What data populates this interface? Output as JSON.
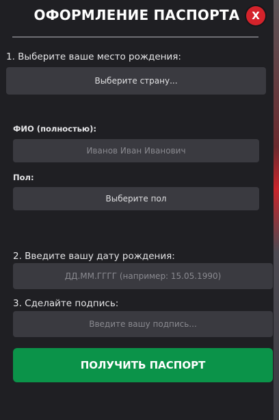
{
  "dialog": {
    "title": "ОФОРМЛЕНИЕ ПАСПОРТА",
    "close_label": "X"
  },
  "step1": {
    "label": "1. Выберите ваше место рождения:",
    "country_select": "Выберите страну..."
  },
  "fio": {
    "label": "ФИО (полностью):",
    "placeholder": "Иванов Иван Иванович"
  },
  "gender": {
    "label": "Пол:",
    "select": "Выберите пол"
  },
  "step2": {
    "label": "2. Введите вашу дату рождения:",
    "placeholder": "ДД.ММ.ГГГГ (например: 15.05.1990)"
  },
  "step3": {
    "label": "3. Сделайте подпись:",
    "placeholder": "Введите вашу подпись..."
  },
  "submit": {
    "label": "ПОЛУЧИТЬ ПАСПОРТ"
  },
  "colors": {
    "accent_green": "#0b9349",
    "close_red": "#d4232b",
    "panel_bg": "#1f1f23",
    "field_bg": "#3a3a40"
  }
}
